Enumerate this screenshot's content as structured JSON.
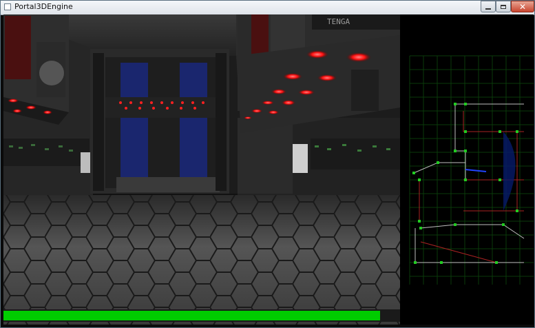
{
  "window": {
    "title": "Portal3DEngine",
    "controls": {
      "minimize": "—",
      "maximize": "□",
      "close": "✕"
    }
  },
  "hud": {
    "health": 0.95,
    "health_color": "#00cc00"
  },
  "scene": {
    "floor_color": "#3a3a3a",
    "ceiling_light_color": "#ff2020",
    "wall_tone": "#2a2a2a",
    "panel_accent": "#1a2a8a",
    "sign_text": "TENGA"
  },
  "minimap": {
    "grid_color": "#003300",
    "wall_color": "#88aa88",
    "portal_color": "#aa2222",
    "player_color": "#2244ff",
    "vertex_color": "#22cc22"
  }
}
